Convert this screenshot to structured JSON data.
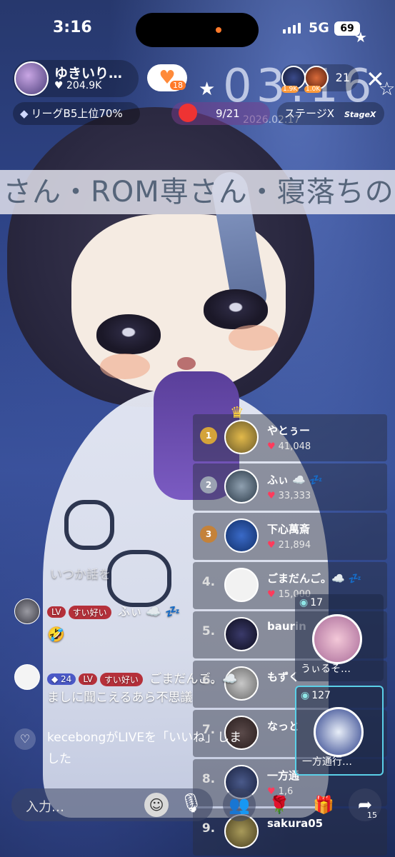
{
  "status_bar": {
    "time": "3:16",
    "network": "5G",
    "battery": "69"
  },
  "host": {
    "name": "ゆきいり…",
    "likes": "204.9K",
    "follow_badge": "18"
  },
  "viewers": {
    "top1_label": "1.9K",
    "top2_label": "1.0K",
    "count": "21"
  },
  "pills": {
    "league": "リーグB5上位70%",
    "event_progress": "9/21",
    "stage": "ステージX",
    "stage_logo": "StageX"
  },
  "background": {
    "banner_text": "さん・ROM専さん・寝落ちの",
    "clock_text": "03:16",
    "date_text": "2026.02.17"
  },
  "ranking": [
    {
      "rank": "1",
      "name": "やとぅー",
      "score": "41,048"
    },
    {
      "rank": "2",
      "name": "ふぃ ☁️ 💤",
      "score": "33,333"
    },
    {
      "rank": "3",
      "name": "下心萬斎",
      "score": "21,894"
    },
    {
      "rank": "4.",
      "name": "ごまだんご。☁️ 💤",
      "score": "15,000"
    },
    {
      "rank": "5.",
      "name": "baurin",
      "score": ""
    },
    {
      "rank": "6.",
      "name": "もずく",
      "score": ""
    },
    {
      "rank": "7.",
      "name": "なっと",
      "score": ""
    },
    {
      "rank": "8.",
      "name": "一方通",
      "score": "1,6"
    },
    {
      "rank": "9.",
      "name": "sakura05",
      "score": ""
    }
  ],
  "rooms": [
    {
      "count": "17",
      "name": "うぃるそ…"
    },
    {
      "count": "127",
      "name": "一方通行…"
    }
  ],
  "comments": [
    {
      "faded": "いつか話を"
    },
    {
      "level": "LV",
      "badge": "すい好い",
      "text": "ふぃ ☁️ 💤",
      "extra": "🤣"
    },
    {
      "level_num": "24",
      "level": "LV",
      "badge": "すい好い",
      "text": "ごまだんご。☁️",
      "line2": "ましに聞こえるあら不思議"
    }
  ],
  "system_message": {
    "line1": "kecebongがLIVEを「いいね」しま",
    "line2": "した"
  },
  "bottom": {
    "input_placeholder": "入力…",
    "share_count": "15"
  }
}
